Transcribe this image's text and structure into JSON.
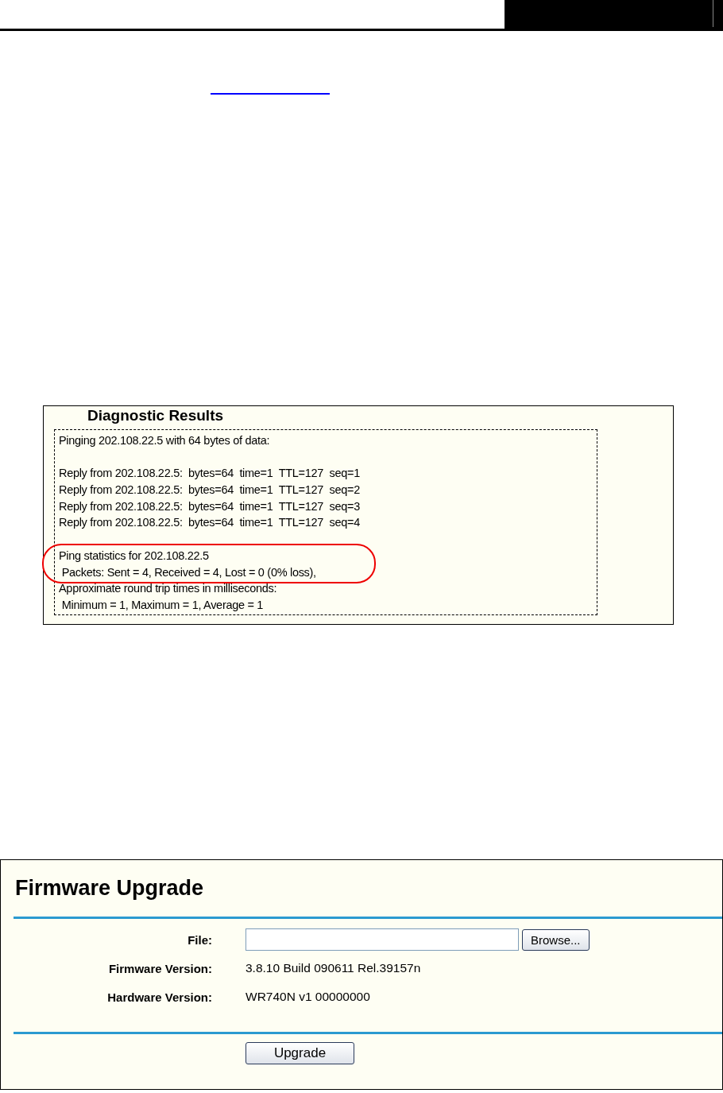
{
  "diagnostic": {
    "title": "Diagnostic Results",
    "blocks": [
      {
        "kind": "first",
        "highlighted": false,
        "lines": [
          "Pinging 202.108.22.5 with 64 bytes of data:"
        ]
      },
      {
        "kind": "paragraph",
        "highlighted": false,
        "lines": [
          "Reply from 202.108.22.5:  bytes=64  time=1  TTL=127  seq=1",
          "Reply from 202.108.22.5:  bytes=64  time=1  TTL=127  seq=2",
          "Reply from 202.108.22.5:  bytes=64  time=1  TTL=127  seq=3",
          "Reply from 202.108.22.5:  bytes=64  time=1  TTL=127  seq=4"
        ]
      },
      {
        "kind": "paragraph",
        "highlighted": true,
        "lines": [
          "Ping statistics for 202.108.22.5",
          " Packets: Sent = 4, Received = 4, Lost = 0 (0% loss),"
        ]
      },
      {
        "kind": "continuation",
        "highlighted": false,
        "lines": [
          "Approximate round trip times in milliseconds:",
          " Minimum = 1, Maximum = 1, Average = 1"
        ]
      }
    ]
  },
  "firmware": {
    "title": "Firmware Upgrade",
    "rows": [
      {
        "kind": "file",
        "label": "File:",
        "button": "Browse..."
      },
      {
        "kind": "text",
        "label": "Firmware Version:",
        "value": "3.8.10 Build 090611 Rel.39157n"
      },
      {
        "kind": "text",
        "label": "Hardware Version:",
        "value": "WR740N v1 00000000"
      }
    ],
    "submit": "Upgrade"
  }
}
